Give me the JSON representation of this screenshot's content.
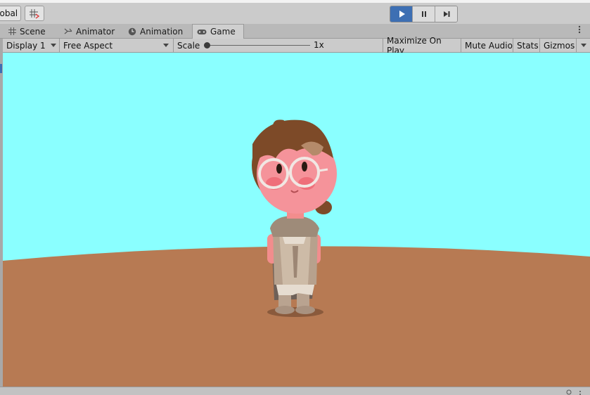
{
  "toolbar": {
    "global_label": "Global"
  },
  "tabs": [
    {
      "label": "Scene",
      "icon": "grid-icon"
    },
    {
      "label": "Animator",
      "icon": "animator-icon"
    },
    {
      "label": "Animation",
      "icon": "clock-icon"
    },
    {
      "label": "Game",
      "icon": "gamepad-icon",
      "active": true
    }
  ],
  "game_controls": {
    "display": "Display 1",
    "aspect": "Free Aspect",
    "scale_label": "Scale",
    "scale_value": "1x",
    "maximize_on_play": "Maximize On Play",
    "mute_audio": "Mute Audio",
    "stats": "Stats",
    "gizmos": "Gizmos"
  },
  "colors": {
    "sky": "#8affff",
    "ground": "#b77a53",
    "play_active": "#3d6fb3"
  }
}
